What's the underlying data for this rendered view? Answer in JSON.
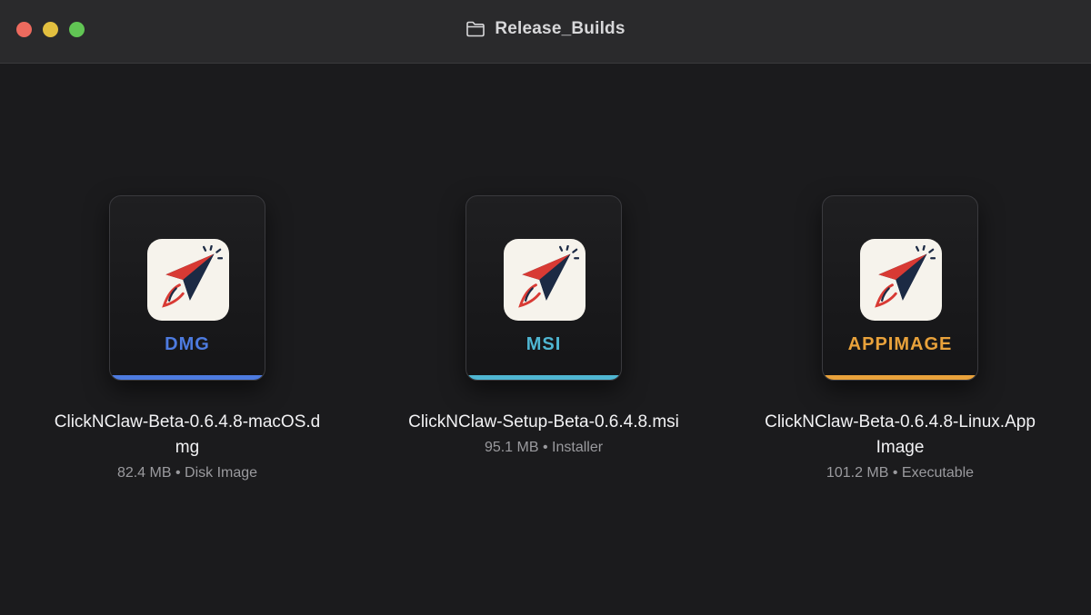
{
  "window": {
    "title": "Release_Builds",
    "folder_icon": "folder-icon"
  },
  "files": [
    {
      "name": "ClickNClaw-Beta-0.6.4.8-macOS.dmg",
      "type_label": "DMG",
      "accent": "#4d7be0",
      "size": "82.4 MB",
      "kind": "Disk Image",
      "icon": "clicknclaw-app-icon"
    },
    {
      "name": "ClickNClaw-Setup-Beta-0.6.4.8.msi",
      "type_label": "MSI",
      "accent": "#4fb6d2",
      "size": "95.1 MB",
      "kind": "Installer",
      "icon": "clicknclaw-app-icon"
    },
    {
      "name": "ClickNClaw-Beta-0.6.4.8-Linux.AppImage",
      "type_label": "APPIMAGE",
      "accent": "#e9a23b",
      "size": "101.2 MB",
      "kind": "Executable",
      "icon": "clicknclaw-app-icon"
    }
  ]
}
